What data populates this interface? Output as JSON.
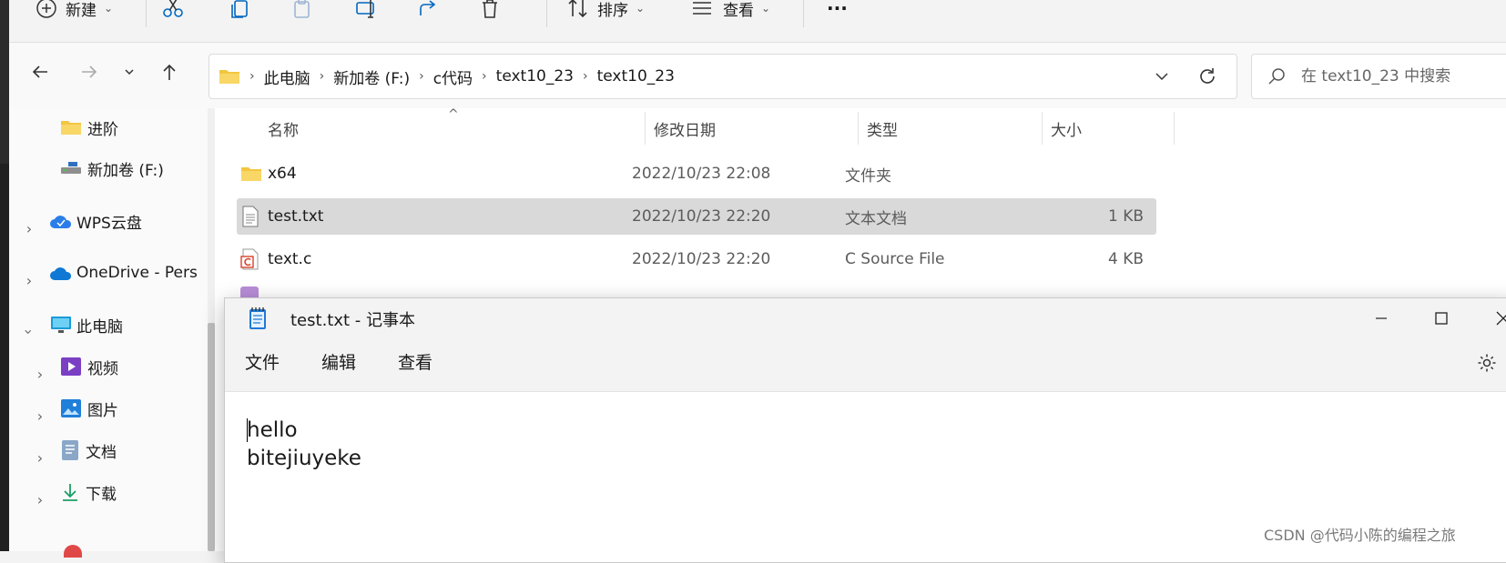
{
  "toolbar": {
    "new_label": "新建",
    "sort_label": "排序",
    "view_label": "查看",
    "more_label": "···"
  },
  "breadcrumbs": [
    "此电脑",
    "新加卷 (F:)",
    "c代码",
    "text10_23",
    "text10_23"
  ],
  "search": {
    "placeholder": "在 text10_23 中搜索"
  },
  "nav_pane": {
    "items": [
      {
        "label": "进阶"
      },
      {
        "label": "新加卷 (F:)"
      },
      {
        "label": "WPS云盘"
      },
      {
        "label": "OneDrive - Pers"
      },
      {
        "label": "此电脑"
      },
      {
        "label": "视频"
      },
      {
        "label": "图片"
      },
      {
        "label": "文档"
      },
      {
        "label": "下载"
      }
    ]
  },
  "file_list": {
    "columns": [
      "名称",
      "修改日期",
      "类型",
      "大小"
    ],
    "rows": [
      {
        "name": "x64",
        "date": "2022/10/23 22:08",
        "type": "文件夹",
        "size": "",
        "icon": "folder-icon"
      },
      {
        "name": "test.txt",
        "date": "2022/10/23 22:20",
        "type": "文本文档",
        "size": "1 KB",
        "icon": "text-file-icon",
        "selected": true
      },
      {
        "name": "text.c",
        "date": "2022/10/23 22:20",
        "type": "C Source File",
        "size": "4 KB",
        "icon": "c-source-file-icon"
      }
    ]
  },
  "notepad": {
    "title": "test.txt - 记事本",
    "menu": [
      "文件",
      "编辑",
      "查看"
    ],
    "content": "hello\nbitejiuyeke"
  },
  "watermark": "CSDN @代码小陈的编程之旅",
  "colors": {
    "selection": "#d9d9d9",
    "folder": "#f3c640",
    "accent": "#0067c0"
  }
}
